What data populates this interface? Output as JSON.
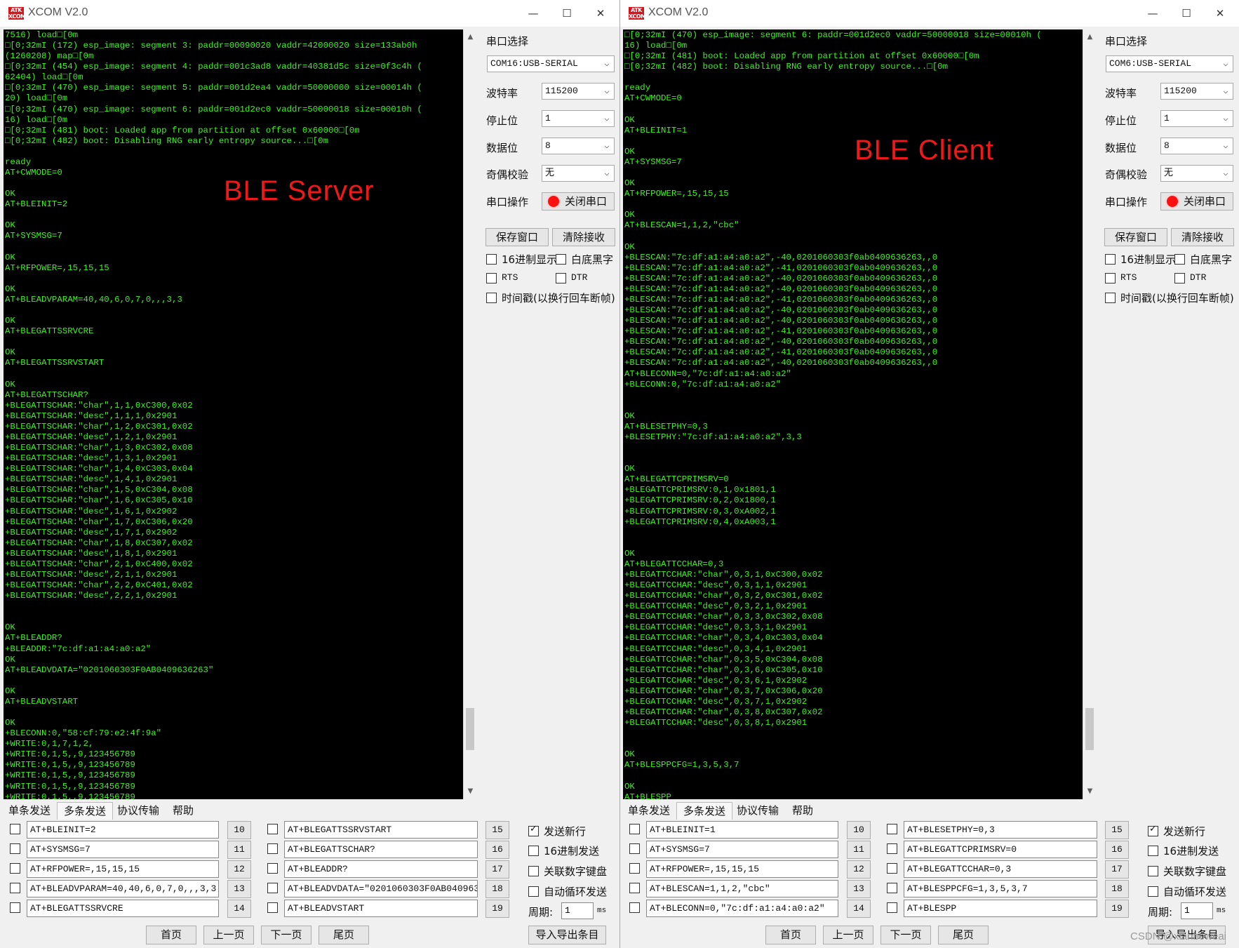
{
  "windows": [
    {
      "id": "left",
      "title": "XCOM V2.0",
      "logo_text": "ATK XCOM",
      "overlay_label": "BLE  Server",
      "terminal_text": "7516) load□[0m\n□[0;32mI (172) esp_image: segment 3: paddr=00090020 vaddr=42000020 size=133ab0h\n(1260208) map□[0m\n□[0;32mI (454) esp_image: segment 4: paddr=001c3ad8 vaddr=40381d5c size=0f3c4h (\n62404) load□[0m\n□[0;32mI (470) esp_image: segment 5: paddr=001d2ea4 vaddr=50000000 size=00014h (\n20) load□[0m\n□[0;32mI (470) esp_image: segment 6: paddr=001d2ec0 vaddr=50000018 size=00010h (\n16) load□[0m\n□[0;32mI (481) boot: Loaded app from partition at offset 0x60000□[0m\n□[0;32mI (482) boot: Disabling RNG early entropy source...□[0m\n\nready\nAT+CWMODE=0\n\nOK\nAT+BLEINIT=2\n\nOK\nAT+SYSMSG=7\n\nOK\nAT+RFPOWER=,15,15,15\n\nOK\nAT+BLEADVPARAM=40,40,6,0,7,0,,,3,3\n\nOK\nAT+BLEGATTSSRVCRE\n\nOK\nAT+BLEGATTSSRVSTART\n\nOK\nAT+BLEGATTSCHAR?\n+BLEGATTSCHAR:\"char\",1,1,0xC300,0x02\n+BLEGATTSCHAR:\"desc\",1,1,1,0x2901\n+BLEGATTSCHAR:\"char\",1,2,0xC301,0x02\n+BLEGATTSCHAR:\"desc\",1,2,1,0x2901\n+BLEGATTSCHAR:\"char\",1,3,0xC302,0x08\n+BLEGATTSCHAR:\"desc\",1,3,1,0x2901\n+BLEGATTSCHAR:\"char\",1,4,0xC303,0x04\n+BLEGATTSCHAR:\"desc\",1,4,1,0x2901\n+BLEGATTSCHAR:\"char\",1,5,0xC304,0x08\n+BLEGATTSCHAR:\"char\",1,6,0xC305,0x10\n+BLEGATTSCHAR:\"desc\",1,6,1,0x2902\n+BLEGATTSCHAR:\"char\",1,7,0xC306,0x20\n+BLEGATTSCHAR:\"desc\",1,7,1,0x2902\n+BLEGATTSCHAR:\"char\",1,8,0xC307,0x02\n+BLEGATTSCHAR:\"desc\",1,8,1,0x2901\n+BLEGATTSCHAR:\"char\",2,1,0xC400,0x02\n+BLEGATTSCHAR:\"desc\",2,1,1,0x2901\n+BLEGATTSCHAR:\"char\",2,2,0xC401,0x02\n+BLEGATTSCHAR:\"desc\",2,2,1,0x2901\n\n\nOK\nAT+BLEADDR?\n+BLEADDR:\"7c:df:a1:a4:a0:a2\"\nOK\nAT+BLEADVDATA=\"0201060303F0AB0409636263\"\n\nOK\nAT+BLEADVSTART\n\nOK\n+BLECONN:0,\"58:cf:79:e2:4f:9a\"\n+WRITE:0,1,7,1,2,\n+WRITE:0,1,5,,9,123456789\n+WRITE:0,1,5,,9,123456789\n+WRITE:0,1,5,,9,123456789\n+WRITE:0,1,5,,9,123456789\n+WRITE:0,1,5,,9,123456789",
      "scroll_position": 0.95,
      "settings": {
        "port_label": "串口选择",
        "port_value": "COM16:USB-SERIAL",
        "baud_label": "波特率",
        "baud_value": "115200",
        "stop_label": "停止位",
        "stop_value": "1",
        "data_label": "数据位",
        "data_value": "8",
        "parity_label": "奇偶校验",
        "parity_value": "无",
        "op_label": "串口操作",
        "op_button": "关闭串口",
        "save_button": "保存窗口",
        "clear_button": "清除接收",
        "hex_display": "16进制显示",
        "white_bg": "白底黑字",
        "rts": "RTS",
        "dtr": "DTR",
        "timestamp": "时间戳(以换行回车断帧)"
      },
      "tabs": [
        "单条发送",
        "多条发送",
        "协议传输",
        "帮助"
      ],
      "active_tab": 1,
      "cmds_left": [
        "AT+BLEINIT=2",
        "AT+SYSMSG=7",
        "AT+RFPOWER=,15,15,15",
        "AT+BLEADVPARAM=40,40,6,0,7,0,,,3,3",
        "AT+BLEGATTSSRVCRE"
      ],
      "nums_left": [
        "10",
        "11",
        "12",
        "13",
        "14"
      ],
      "cmds_right": [
        "AT+BLEGATTSSRVSTART",
        "AT+BLEGATTSCHAR?",
        "AT+BLEADDR?",
        "AT+BLEADVDATA=\"0201060303F0AB0409636",
        "AT+BLEADVSTART"
      ],
      "nums_right": [
        "15",
        "16",
        "17",
        "18",
        "19"
      ],
      "opts": {
        "newline": "发送新行",
        "hex_send": "16进制发送",
        "link_keypad": "关联数字键盘",
        "auto_loop": "自动循环发送",
        "period_label": "周期:",
        "period_value": "1",
        "period_unit": "ms"
      },
      "nav": {
        "first": "首页",
        "prev": "上一页",
        "next": "下一页",
        "last": "尾页",
        "import_export": "导入导出条目"
      }
    },
    {
      "id": "right",
      "title": "XCOM V2.0",
      "logo_text": "ATK XCOM",
      "overlay_label": "BLE  Client",
      "terminal_text": "□[0;32mI (470) esp_image: segment 6: paddr=001d2ec0 vaddr=50000018 size=00010h (\n16) load□[0m\n□[0;32mI (481) boot: Loaded app from partition at offset 0x60000□[0m\n□[0;32mI (482) boot: Disabling RNG early entropy source...□[0m\n\nready\nAT+CWMODE=0\n\nOK\nAT+BLEINIT=1\n\nOK\nAT+SYSMSG=7\n\nOK\nAT+RFPOWER=,15,15,15\n\nOK\nAT+BLESCAN=1,1,2,\"cbc\"\n\nOK\n+BLESCAN:\"7c:df:a1:a4:a0:a2\",-40,0201060303f0ab0409636263,,0\n+BLESCAN:\"7c:df:a1:a4:a0:a2\",-41,0201060303f0ab0409636263,,0\n+BLESCAN:\"7c:df:a1:a4:a0:a2\",-40,0201060303f0ab0409636263,,0\n+BLESCAN:\"7c:df:a1:a4:a0:a2\",-40,0201060303f0ab0409636263,,0\n+BLESCAN:\"7c:df:a1:a4:a0:a2\",-41,0201060303f0ab0409636263,,0\n+BLESCAN:\"7c:df:a1:a4:a0:a2\",-40,0201060303f0ab0409636263,,0\n+BLESCAN:\"7c:df:a1:a4:a0:a2\",-40,0201060303f0ab0409636263,,0\n+BLESCAN:\"7c:df:a1:a4:a0:a2\",-41,0201060303f0ab0409636263,,0\n+BLESCAN:\"7c:df:a1:a4:a0:a2\",-40,0201060303f0ab0409636263,,0\n+BLESCAN:\"7c:df:a1:a4:a0:a2\",-41,0201060303f0ab0409636263,,0\n+BLESCAN:\"7c:df:a1:a4:a0:a2\",-40,0201060303f0ab0409636263,,0\nAT+BLECONN=0,\"7c:df:a1:a4:a0:a2\"\n+BLECONN:0,\"7c:df:a1:a4:a0:a2\"\n\n\nOK\nAT+BLESETPHY=0,3\n+BLESETPHY:\"7c:df:a1:a4:a0:a2\",3,3\n\n\nOK\nAT+BLEGATTCPRIMSRV=0\n+BLEGATTCPRIMSRV:0,1,0x1801,1\n+BLEGATTCPRIMSRV:0,2,0x1800,1\n+BLEGATTCPRIMSRV:0,3,0xA002,1\n+BLEGATTCPRIMSRV:0,4,0xA003,1\n\n\nOK\nAT+BLEGATTCCHAR=0,3\n+BLEGATTCCHAR:\"char\",0,3,1,0xC300,0x02\n+BLEGATTCCHAR:\"desc\",0,3,1,1,0x2901\n+BLEGATTCCHAR:\"char\",0,3,2,0xC301,0x02\n+BLEGATTCCHAR:\"desc\",0,3,2,1,0x2901\n+BLEGATTCCHAR:\"char\",0,3,3,0xC302,0x08\n+BLEGATTCCHAR:\"desc\",0,3,3,1,0x2901\n+BLEGATTCCHAR:\"char\",0,3,4,0xC303,0x04\n+BLEGATTCCHAR:\"desc\",0,3,4,1,0x2901\n+BLEGATTCCHAR:\"char\",0,3,5,0xC304,0x08\n+BLEGATTCCHAR:\"char\",0,3,6,0xC305,0x10\n+BLEGATTCCHAR:\"desc\",0,3,6,1,0x2902\n+BLEGATTCCHAR:\"char\",0,3,7,0xC306,0x20\n+BLEGATTCCHAR:\"desc\",0,3,7,1,0x2902\n+BLEGATTCCHAR:\"char\",0,3,8,0xC307,0x02\n+BLEGATTCCHAR:\"desc\",0,3,8,1,0x2901\n\n\nOK\nAT+BLESPPCFG=1,3,5,3,7\n\nOK\nAT+BLESPP\n\nOK\n>",
      "scroll_position": 0.95,
      "settings": {
        "port_label": "串口选择",
        "port_value": "COM6:USB-SERIAL",
        "baud_label": "波特率",
        "baud_value": "115200",
        "stop_label": "停止位",
        "stop_value": "1",
        "data_label": "数据位",
        "data_value": "8",
        "parity_label": "奇偶校验",
        "parity_value": "无",
        "op_label": "串口操作",
        "op_button": "关闭串口",
        "save_button": "保存窗口",
        "clear_button": "清除接收",
        "hex_display": "16进制显示",
        "white_bg": "白底黑字",
        "rts": "RTS",
        "dtr": "DTR",
        "timestamp": "时间戳(以换行回车断帧)"
      },
      "tabs": [
        "单条发送",
        "多条发送",
        "协议传输",
        "帮助"
      ],
      "active_tab": 1,
      "cmds_left": [
        "AT+BLEINIT=1",
        "AT+SYSMSG=7",
        "AT+RFPOWER=,15,15,15",
        "AT+BLESCAN=1,1,2,\"cbc\"",
        "AT+BLECONN=0,\"7c:df:a1:a4:a0:a2\""
      ],
      "nums_left": [
        "10",
        "11",
        "12",
        "13",
        "14"
      ],
      "cmds_right": [
        "AT+BLESETPHY=0,3",
        "AT+BLEGATTCPRIMSRV=0",
        "AT+BLEGATTCCHAR=0,3",
        "AT+BLESPPCFG=1,3,5,3,7",
        "AT+BLESPP"
      ],
      "nums_right": [
        "15",
        "16",
        "17",
        "18",
        "19"
      ],
      "opts": {
        "newline": "发送新行",
        "hex_send": "16进制发送",
        "link_keypad": "关联数字键盘",
        "auto_loop": "自动循环发送",
        "period_label": "周期:",
        "period_value": "1",
        "period_unit": "ms"
      },
      "nav": {
        "first": "首页",
        "prev": "上一页",
        "next": "下一页",
        "last": "尾页",
        "import_export": "导入导出条目"
      }
    }
  ],
  "watermark": "CSDN @xianboweai",
  "colors": {
    "terminal_bg": "#000000",
    "terminal_text": "#40f020",
    "overlay_label": "#f01818",
    "window_bg": "#f0f0f0"
  }
}
